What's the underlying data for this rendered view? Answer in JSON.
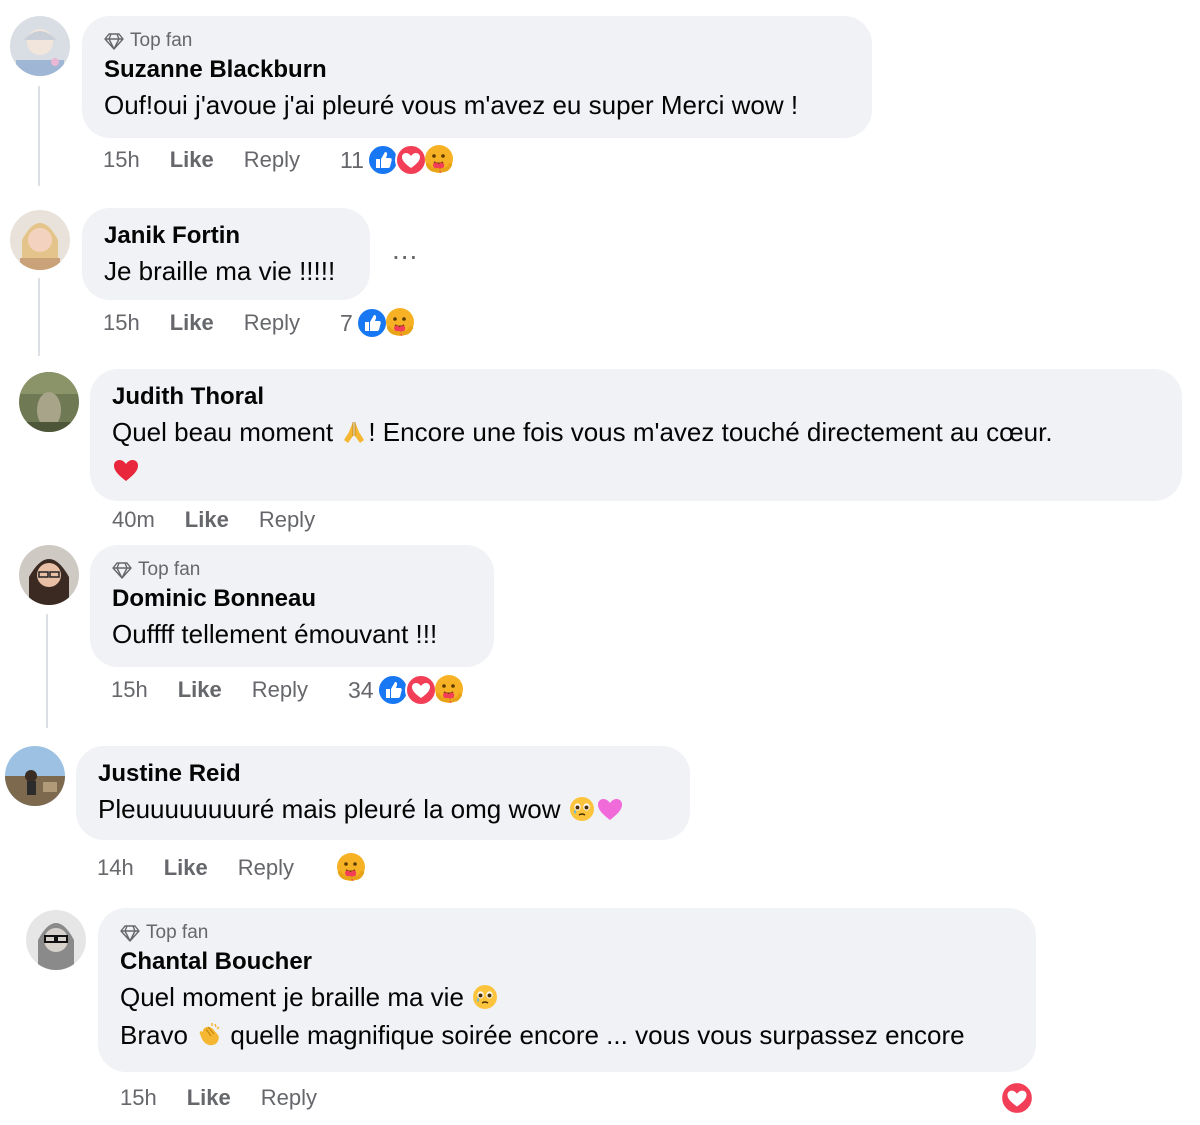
{
  "comments": [
    {
      "badge": "Top fan",
      "author": "Suzanne Blackburn",
      "text": "Ouf!oui j'avoue j'ai pleuré vous m'avez eu super Merci wow !",
      "time": "15h",
      "like": "Like",
      "reply": "Reply",
      "reaction_count": "11",
      "reactions": [
        "like-icon",
        "love-icon",
        "care-icon"
      ]
    },
    {
      "author": "Janik Fortin",
      "text": "Je braille ma vie !!!!!",
      "more": "...",
      "time": "15h",
      "like": "Like",
      "reply": "Reply",
      "reaction_count": "7",
      "reactions": [
        "like-icon",
        "care-icon"
      ]
    },
    {
      "author": "Judith Thoral",
      "text_a": "Quel beau moment ",
      "text_b": "! Encore une fois vous m'avez touché directement au cœur.",
      "time": "40m",
      "like": "Like",
      "reply": "Reply"
    },
    {
      "badge": "Top fan",
      "author": "Dominic Bonneau",
      "text": "Ouffff tellement émouvant !!!",
      "time": "15h",
      "like": "Like",
      "reply": "Reply",
      "reaction_count": "34",
      "reactions": [
        "like-icon",
        "love-icon",
        "care-icon"
      ]
    },
    {
      "author": "Justine Reid",
      "text": "Pleuuuuuuuuré mais pleuré la omg wow ",
      "time": "14h",
      "like": "Like",
      "reply": "Reply",
      "reactions": [
        "care-icon"
      ]
    },
    {
      "badge": "Top fan",
      "author": "Chantal Boucher",
      "line1": "Quel moment je braille ma vie ",
      "line2_a": "Bravo ",
      "line2_b": " quelle magnifique soirée encore ... vous vous surpassez encore",
      "time": "15h",
      "like": "Like",
      "reply": "Reply",
      "reactions": [
        "love-icon"
      ]
    }
  ],
  "colors": {
    "bubble": "#f0f2f5",
    "meta_text": "#65676b",
    "like_blue": "#1877f2",
    "love_red": "#f33e58",
    "care_yellow": "#f7b125"
  }
}
